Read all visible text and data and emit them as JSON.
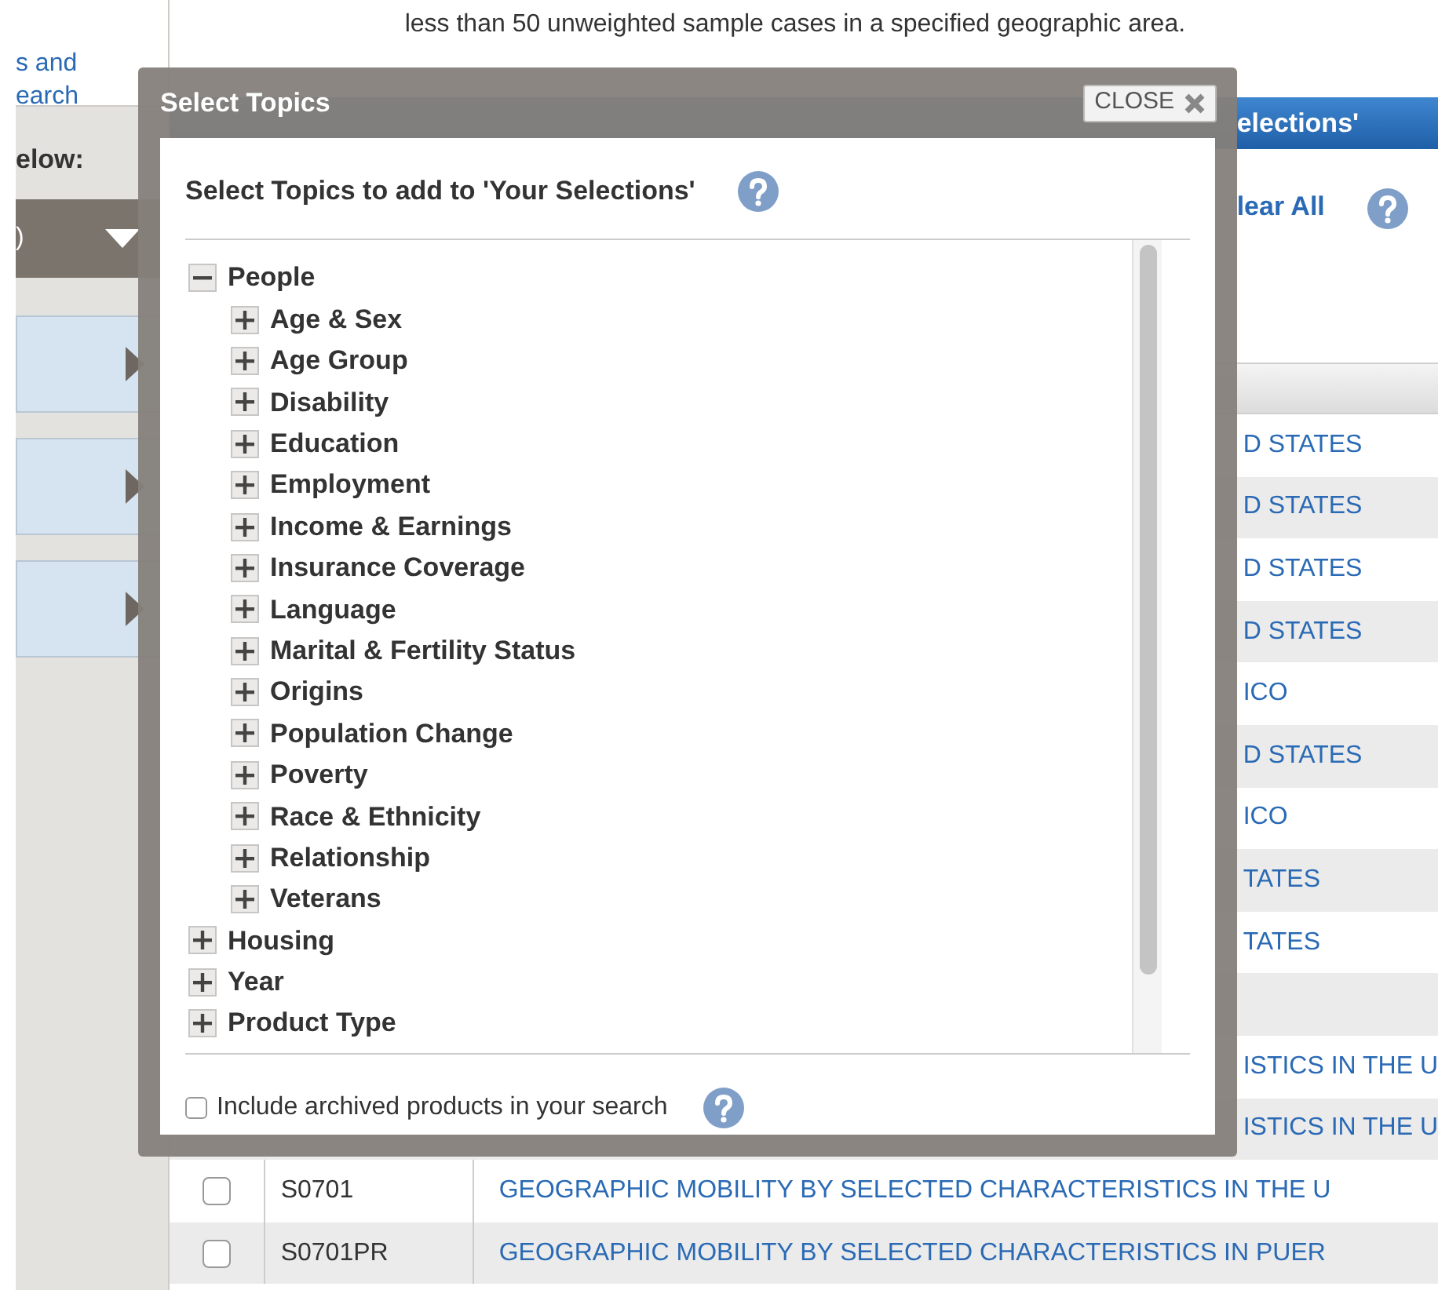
{
  "top_note": "less than 50 unweighted sample cases in a specified geographic area.",
  "sidebar": {
    "link_lines": [
      "s and",
      "earch"
    ],
    "heading": "elow:",
    "dropdown_text": ")"
  },
  "banner_text": "elections'",
  "clear_link": "lear All",
  "table_rows": [
    {
      "title": "D STATES"
    },
    {
      "title": "D STATES"
    },
    {
      "title": "D STATES"
    },
    {
      "title": "D STATES"
    },
    {
      "title": "ICO"
    },
    {
      "title": "D STATES"
    },
    {
      "title": "ICO"
    },
    {
      "title": "TATES"
    },
    {
      "title": "TATES"
    },
    {
      "title": ""
    },
    {
      "title": "ISTICS IN THE U"
    },
    {
      "title": "ISTICS IN THE U"
    },
    {
      "code": "S0701",
      "title": "GEOGRAPHIC MOBILITY BY SELECTED CHARACTERISTICS IN THE U",
      "checked": false
    },
    {
      "code": "S0701PR",
      "title": "GEOGRAPHIC MOBILITY BY SELECTED CHARACTERISTICS IN PUER",
      "checked": false
    }
  ],
  "modal": {
    "title": "Select Topics",
    "close_label": "CLOSE",
    "heading": "Select Topics to add to 'Your Selections'",
    "tree": [
      {
        "label": "People",
        "expanded": true,
        "children": [
          {
            "label": "Age & Sex",
            "expanded": false
          },
          {
            "label": "Age Group",
            "expanded": false
          },
          {
            "label": "Disability",
            "expanded": false
          },
          {
            "label": "Education",
            "expanded": false
          },
          {
            "label": "Employment",
            "expanded": false
          },
          {
            "label": "Income & Earnings",
            "expanded": false
          },
          {
            "label": "Insurance Coverage",
            "expanded": false
          },
          {
            "label": "Language",
            "expanded": false
          },
          {
            "label": "Marital & Fertility Status",
            "expanded": false
          },
          {
            "label": "Origins",
            "expanded": false
          },
          {
            "label": "Population Change",
            "expanded": false
          },
          {
            "label": "Poverty",
            "expanded": false
          },
          {
            "label": "Race & Ethnicity",
            "expanded": false
          },
          {
            "label": "Relationship",
            "expanded": false
          },
          {
            "label": "Veterans",
            "expanded": false
          }
        ]
      },
      {
        "label": "Housing",
        "expanded": false
      },
      {
        "label": "Year",
        "expanded": false
      },
      {
        "label": "Product Type",
        "expanded": false
      }
    ],
    "archived": {
      "label": "Include archived products in your search",
      "checked": false
    }
  }
}
